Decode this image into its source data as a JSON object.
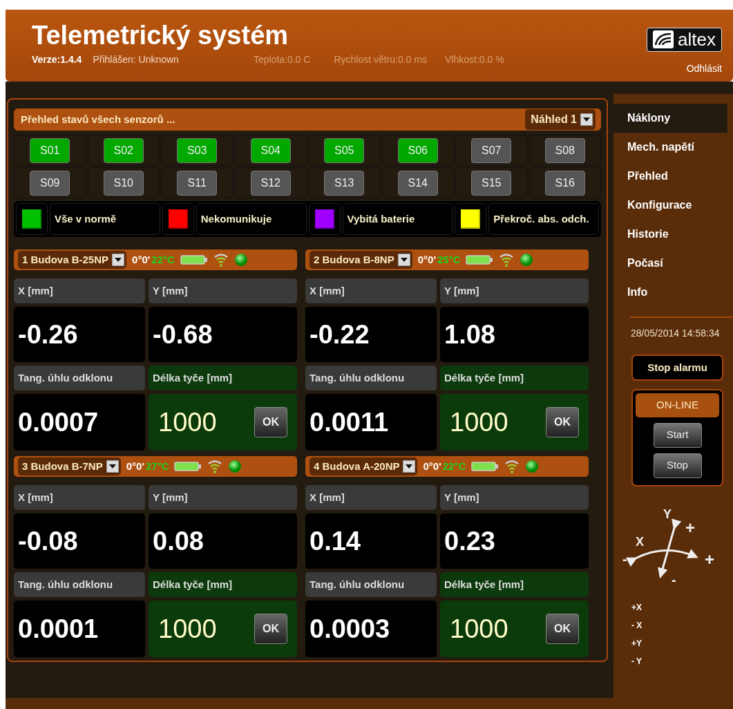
{
  "header": {
    "title": "Telemetrický systém",
    "version": "Verze:1.4.4",
    "user": "Přihlášen: Unknown",
    "temperature": "Teplota:0.0 C",
    "wind": "Rychlost větru:0.0 ms",
    "humidity": "Vlhkost:0.0 %",
    "logo": "altex",
    "logout": "Odhlásit"
  },
  "overview": {
    "title": "Přehled stavů všech senzorů ...",
    "view_select": "Náhled 1",
    "sensors": [
      {
        "label": "S01",
        "color": "#00a800"
      },
      {
        "label": "S02",
        "color": "#00a800"
      },
      {
        "label": "S03",
        "color": "#00a800"
      },
      {
        "label": "S04",
        "color": "#00a800"
      },
      {
        "label": "S05",
        "color": "#00a800"
      },
      {
        "label": "S06",
        "color": "#00a800"
      },
      {
        "label": "S07",
        "color": "#555555"
      },
      {
        "label": "S08",
        "color": "#555555"
      },
      {
        "label": "S09",
        "color": "#555555"
      },
      {
        "label": "S10",
        "color": "#555555"
      },
      {
        "label": "S11",
        "color": "#555555"
      },
      {
        "label": "S12",
        "color": "#555555"
      },
      {
        "label": "S13",
        "color": "#555555"
      },
      {
        "label": "S14",
        "color": "#555555"
      },
      {
        "label": "S15",
        "color": "#555555"
      },
      {
        "label": "S16",
        "color": "#555555"
      }
    ],
    "legend": [
      {
        "label": "Vše v normě",
        "color": "#00c000"
      },
      {
        "label": "Nekomunikuje",
        "color": "#ff0000"
      },
      {
        "label": "Vybitá baterie",
        "color": "#a000ff"
      },
      {
        "label": "Překroč. abs. odch.",
        "color": "#ffff00"
      }
    ],
    "panels": [
      {
        "name": "1 Budova B-25NP",
        "angle": "0°0'",
        "temperature": "22°C",
        "x_label": "X [mm]",
        "x_value": "-0.26",
        "y_label": "Y [mm]",
        "y_value": "-0.68",
        "tang_label": "Tang. úhlu odklonu",
        "tang_value": "0.0007",
        "length_label": "Délka tyče [mm]",
        "length_value": "1000",
        "button": "OK"
      },
      {
        "name": "2 Budova B-8NP",
        "angle": "0°0'",
        "temperature": "25°C",
        "x_label": "X [mm]",
        "x_value": "-0.22",
        "y_label": "Y [mm]",
        "y_value": "1.08",
        "tang_label": "Tang. úhlu odklonu",
        "tang_value": "0.0011",
        "length_label": "Délka tyče [mm]",
        "length_value": "1000",
        "button": "OK"
      },
      {
        "name": "3 Budova B-7NP",
        "angle": "0°0'",
        "temperature": "27°C",
        "x_label": "X [mm]",
        "x_value": "-0.08",
        "y_label": "Y [mm]",
        "y_value": "0.08",
        "tang_label": "Tang. úhlu odklonu",
        "tang_value": "0.0001",
        "length_label": "Délka tyče [mm]",
        "length_value": "1000",
        "button": "OK"
      },
      {
        "name": "4 Budova A-20NP",
        "angle": "0°0'",
        "temperature": "22°C",
        "x_label": "X [mm]",
        "x_value": "0.14",
        "y_label": "Y [mm]",
        "y_value": "0.23",
        "tang_label": "Tang. úhlu odklonu",
        "tang_value": "0.0003",
        "length_label": "Délka tyče [mm]",
        "length_value": "1000",
        "button": "OK"
      }
    ]
  },
  "sidebar": {
    "nav": [
      {
        "label": "Náklony",
        "selected": true
      },
      {
        "label": "Mech. napětí",
        "selected": false
      },
      {
        "label": "Přehled",
        "selected": false
      },
      {
        "label": "Konfigurace",
        "selected": false
      },
      {
        "label": "Historie",
        "selected": false
      },
      {
        "label": "Počasí",
        "selected": false
      },
      {
        "label": "Info",
        "selected": false
      }
    ],
    "datetime": "28/05/2014 14:58:34",
    "alarm_button": "Stop alarmu",
    "mode": "ON-LINE",
    "buttons": [
      "Start",
      "Stop"
    ],
    "axes_diagram": {
      "x_label": "X",
      "y_label": "Y",
      "x_minus": "-",
      "x_plus": "+",
      "y_plus": "+",
      "y_minus": "-"
    },
    "axis_list": [
      "+X",
      "- X",
      "+Y",
      "- Y"
    ]
  }
}
